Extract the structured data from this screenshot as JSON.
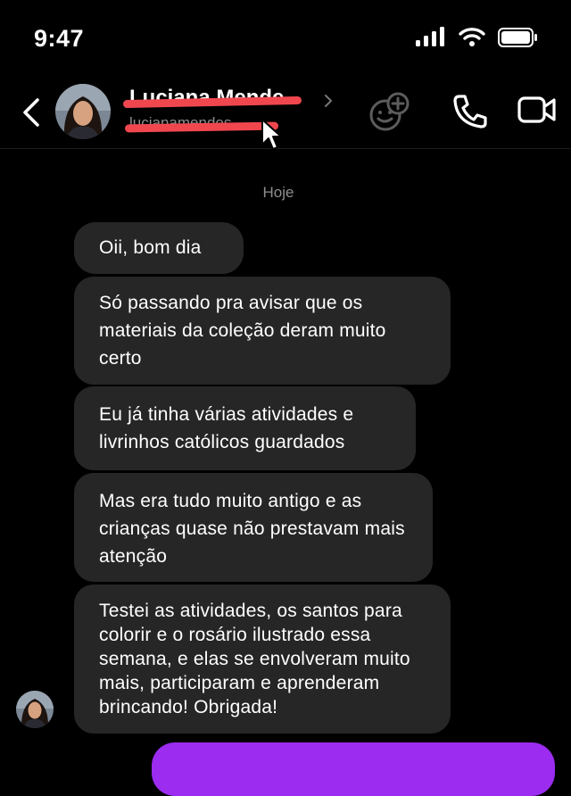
{
  "status_bar": {
    "time": "9:47"
  },
  "header": {
    "contact_name": "Luciana Mende.",
    "contact_subtitle": "lucianamendes"
  },
  "thread": {
    "day_label": "Hoje",
    "messages": [
      {
        "text": "Oii, bom dia"
      },
      {
        "text": "Só passando pra avisar que os materiais da coleção deram muito certo"
      },
      {
        "text": "Eu já tinha várias atividades e livrinhos católicos guardados"
      },
      {
        "text": "Mas era tudo muito antigo e as crianças quase não prestavam mais atenção"
      },
      {
        "text": "Testei as atividades, os santos para colorir e o rosário ilustrado essa semana, e elas se envolveram muito mais, participaram e aprenderam brincando! Obrigada!"
      }
    ]
  },
  "colors": {
    "background": "#000000",
    "bubble_incoming": "#262626",
    "bubble_outgoing": "#9b2cf0",
    "redaction": "#f0474f",
    "muted_text": "#8e8e8e"
  },
  "icons": [
    "back-chevron-icon",
    "sticker-add-icon",
    "phone-icon",
    "video-camera-icon",
    "signal-icon",
    "wifi-icon",
    "battery-icon",
    "cursor-icon"
  ]
}
